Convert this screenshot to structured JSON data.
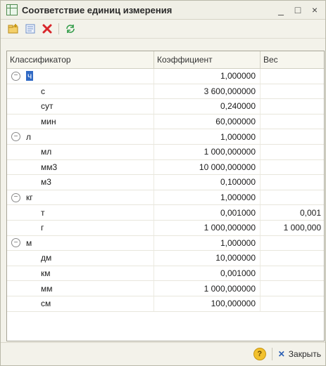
{
  "window": {
    "title": "Соответствие единиц измерения",
    "minimize": "_",
    "maximize": "□",
    "close": "×"
  },
  "toolbar": {
    "add_icon": "add-folder-icon",
    "edit_icon": "edit-list-icon",
    "delete_icon": "delete-icon",
    "refresh_icon": "refresh-icon"
  },
  "grid": {
    "columns": [
      "Классификатор",
      "Коэффициент",
      "Вес"
    ],
    "rows": [
      {
        "unit": "ч",
        "coef": "1,000000",
        "weight": "",
        "group": true,
        "selected": true
      },
      {
        "unit": "с",
        "coef": "3 600,000000",
        "weight": ""
      },
      {
        "unit": "сут",
        "coef": "0,240000",
        "weight": ""
      },
      {
        "unit": "мин",
        "coef": "60,000000",
        "weight": ""
      },
      {
        "unit": "л",
        "coef": "1,000000",
        "weight": "",
        "group": true
      },
      {
        "unit": "мл",
        "coef": "1 000,000000",
        "weight": ""
      },
      {
        "unit": "мм3",
        "coef": "10 000,000000",
        "weight": ""
      },
      {
        "unit": "м3",
        "coef": "0,100000",
        "weight": ""
      },
      {
        "unit": "кг",
        "coef": "1,000000",
        "weight": "",
        "group": true
      },
      {
        "unit": "т",
        "coef": "0,001000",
        "weight": "0,001"
      },
      {
        "unit": "г",
        "coef": "1 000,000000",
        "weight": "1 000,000"
      },
      {
        "unit": "м",
        "coef": "1,000000",
        "weight": "",
        "group": true
      },
      {
        "unit": "дм",
        "coef": "10,000000",
        "weight": ""
      },
      {
        "unit": "км",
        "coef": "0,001000",
        "weight": ""
      },
      {
        "unit": "мм",
        "coef": "1 000,000000",
        "weight": ""
      },
      {
        "unit": "см",
        "coef": "100,000000",
        "weight": ""
      }
    ]
  },
  "footer": {
    "help_label": "?",
    "close_label": "Закрыть"
  }
}
